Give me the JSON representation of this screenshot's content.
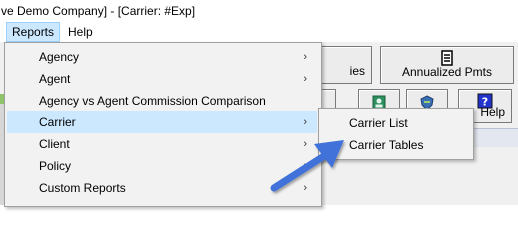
{
  "window": {
    "title": "ve Demo Company] - [Carrier: #Exp]"
  },
  "menubar": {
    "reports": "Reports",
    "help": "Help"
  },
  "toolbar": {
    "partial_label": "ies",
    "annualized_label": "Annualized Pmts",
    "help_label": "Help"
  },
  "reports_menu": {
    "items": [
      {
        "label": "Agency",
        "submenu": true
      },
      {
        "label": "Agent",
        "submenu": true
      },
      {
        "label": "Agency vs Agent Commission Comparison",
        "submenu": false
      },
      {
        "label": "Carrier",
        "submenu": true
      },
      {
        "label": "Client",
        "submenu": true
      },
      {
        "label": "Policy",
        "submenu": true
      },
      {
        "label": "Custom Reports",
        "submenu": true
      }
    ],
    "arrow_glyph": "›"
  },
  "carrier_submenu": {
    "items": [
      {
        "label": "Carrier List"
      },
      {
        "label": "Carrier Tables"
      }
    ]
  },
  "colors": {
    "highlight": "#cce8ff",
    "pointer_arrow": "#3f72d9"
  }
}
